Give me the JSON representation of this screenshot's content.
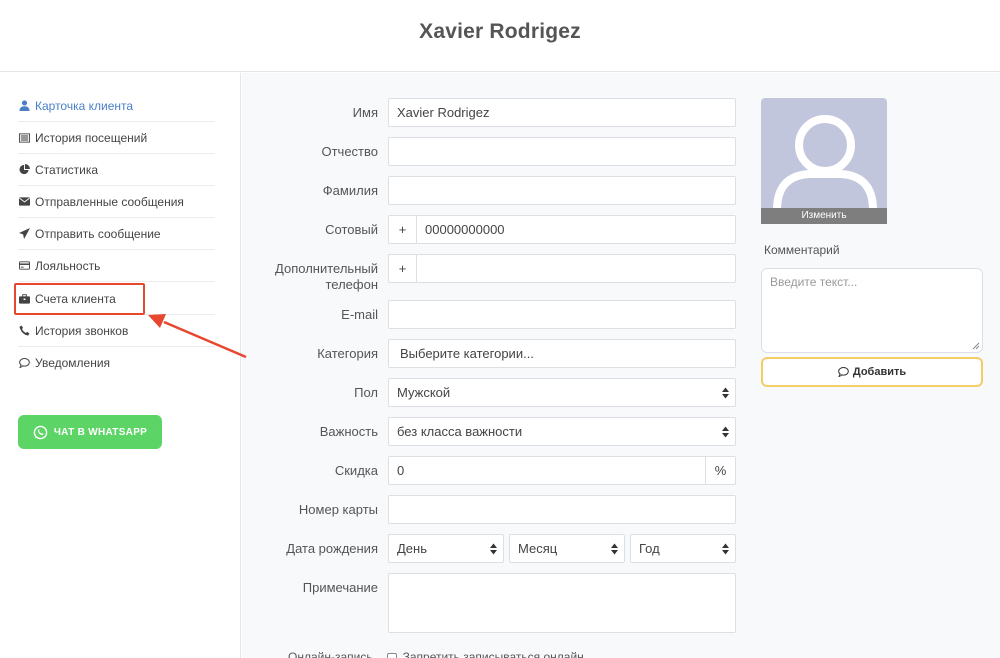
{
  "header": {
    "title": "Xavier Rodrigez"
  },
  "sidebar": {
    "items": [
      {
        "label": "Карточка клиента",
        "icon": "user-icon",
        "active": true
      },
      {
        "label": "История посещений",
        "icon": "list-icon"
      },
      {
        "label": "Статистика",
        "icon": "pie-chart-icon"
      },
      {
        "label": "Отправленные сообщения",
        "icon": "envelope-icon"
      },
      {
        "label": "Отправить сообщение",
        "icon": "paper-plane-icon"
      },
      {
        "label": "Лояльность",
        "icon": "credit-card-icon"
      },
      {
        "label": "Счета клиента",
        "icon": "briefcase-icon"
      },
      {
        "label": "История звонков",
        "icon": "phone-icon"
      },
      {
        "label": "Уведомления",
        "icon": "comment-icon"
      }
    ],
    "whatsapp_button": "ЧАТ В WHATSAPP"
  },
  "form": {
    "first_name": {
      "label": "Имя",
      "value": "Xavier Rodrigez"
    },
    "patronymic": {
      "label": "Отчество",
      "value": ""
    },
    "last_name": {
      "label": "Фамилия",
      "value": ""
    },
    "mobile": {
      "label": "Сотовый",
      "prefix": "+",
      "value": "00000000000"
    },
    "extra_phone": {
      "label_line1": "Дополнительный",
      "label_line2": "телефон",
      "prefix": "+",
      "value": ""
    },
    "email": {
      "label": "E-mail",
      "value": ""
    },
    "category": {
      "label": "Категория",
      "placeholder": "Выберите категории..."
    },
    "gender": {
      "label": "Пол",
      "value": "Мужской"
    },
    "importance": {
      "label": "Важность",
      "value": "без класса важности"
    },
    "discount": {
      "label": "Скидка",
      "value": "0",
      "suffix": "%"
    },
    "card_number": {
      "label": "Номер карты",
      "value": ""
    },
    "birthday": {
      "label": "Дата рождения",
      "day": "День",
      "month": "Месяц",
      "year": "Год"
    },
    "note": {
      "label": "Примечание",
      "value": ""
    },
    "online_booking": {
      "label": "Онлайн-запись",
      "checkbox_label": "Запретить записываться онлайн"
    }
  },
  "photo": {
    "change_label": "Изменить"
  },
  "comment": {
    "label": "Комментарий",
    "placeholder": "Введите текст...",
    "add_button": "Добавить"
  },
  "colors": {
    "active_link": "#4a7fc7",
    "whatsapp": "#5dd466",
    "highlight": "#e8472f",
    "add_border": "#f3cf63"
  }
}
